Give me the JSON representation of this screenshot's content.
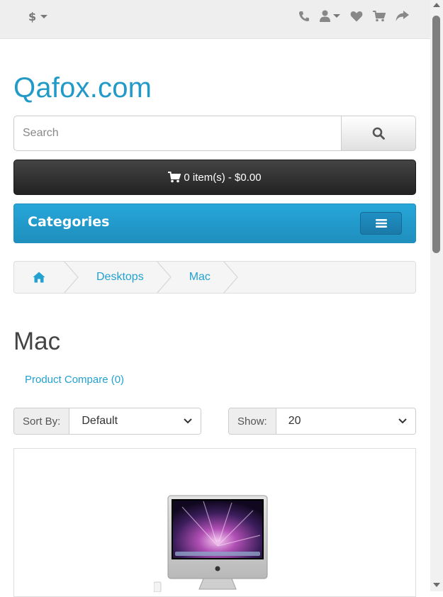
{
  "topbar": {
    "currency_symbol": "$",
    "icons": [
      "phone-icon",
      "user-icon",
      "heart-icon",
      "cart-icon",
      "share-icon"
    ]
  },
  "logo": {
    "text": "Qafox.com",
    "color": "#229ac8"
  },
  "search": {
    "placeholder": "Search",
    "value": ""
  },
  "cart": {
    "label": "0 item(s) - $0.00"
  },
  "menu": {
    "title": "Categories"
  },
  "breadcrumb": {
    "items": [
      "Desktops",
      "Mac"
    ]
  },
  "page": {
    "title": "Mac",
    "compare_label": "Product Compare (0)"
  },
  "sort": {
    "label": "Sort By:",
    "value": "Default"
  },
  "limit": {
    "label": "Show:",
    "value": "20"
  },
  "colors": {
    "accent": "#229ac8",
    "link": "#23a1d1",
    "dark": "#333333"
  }
}
